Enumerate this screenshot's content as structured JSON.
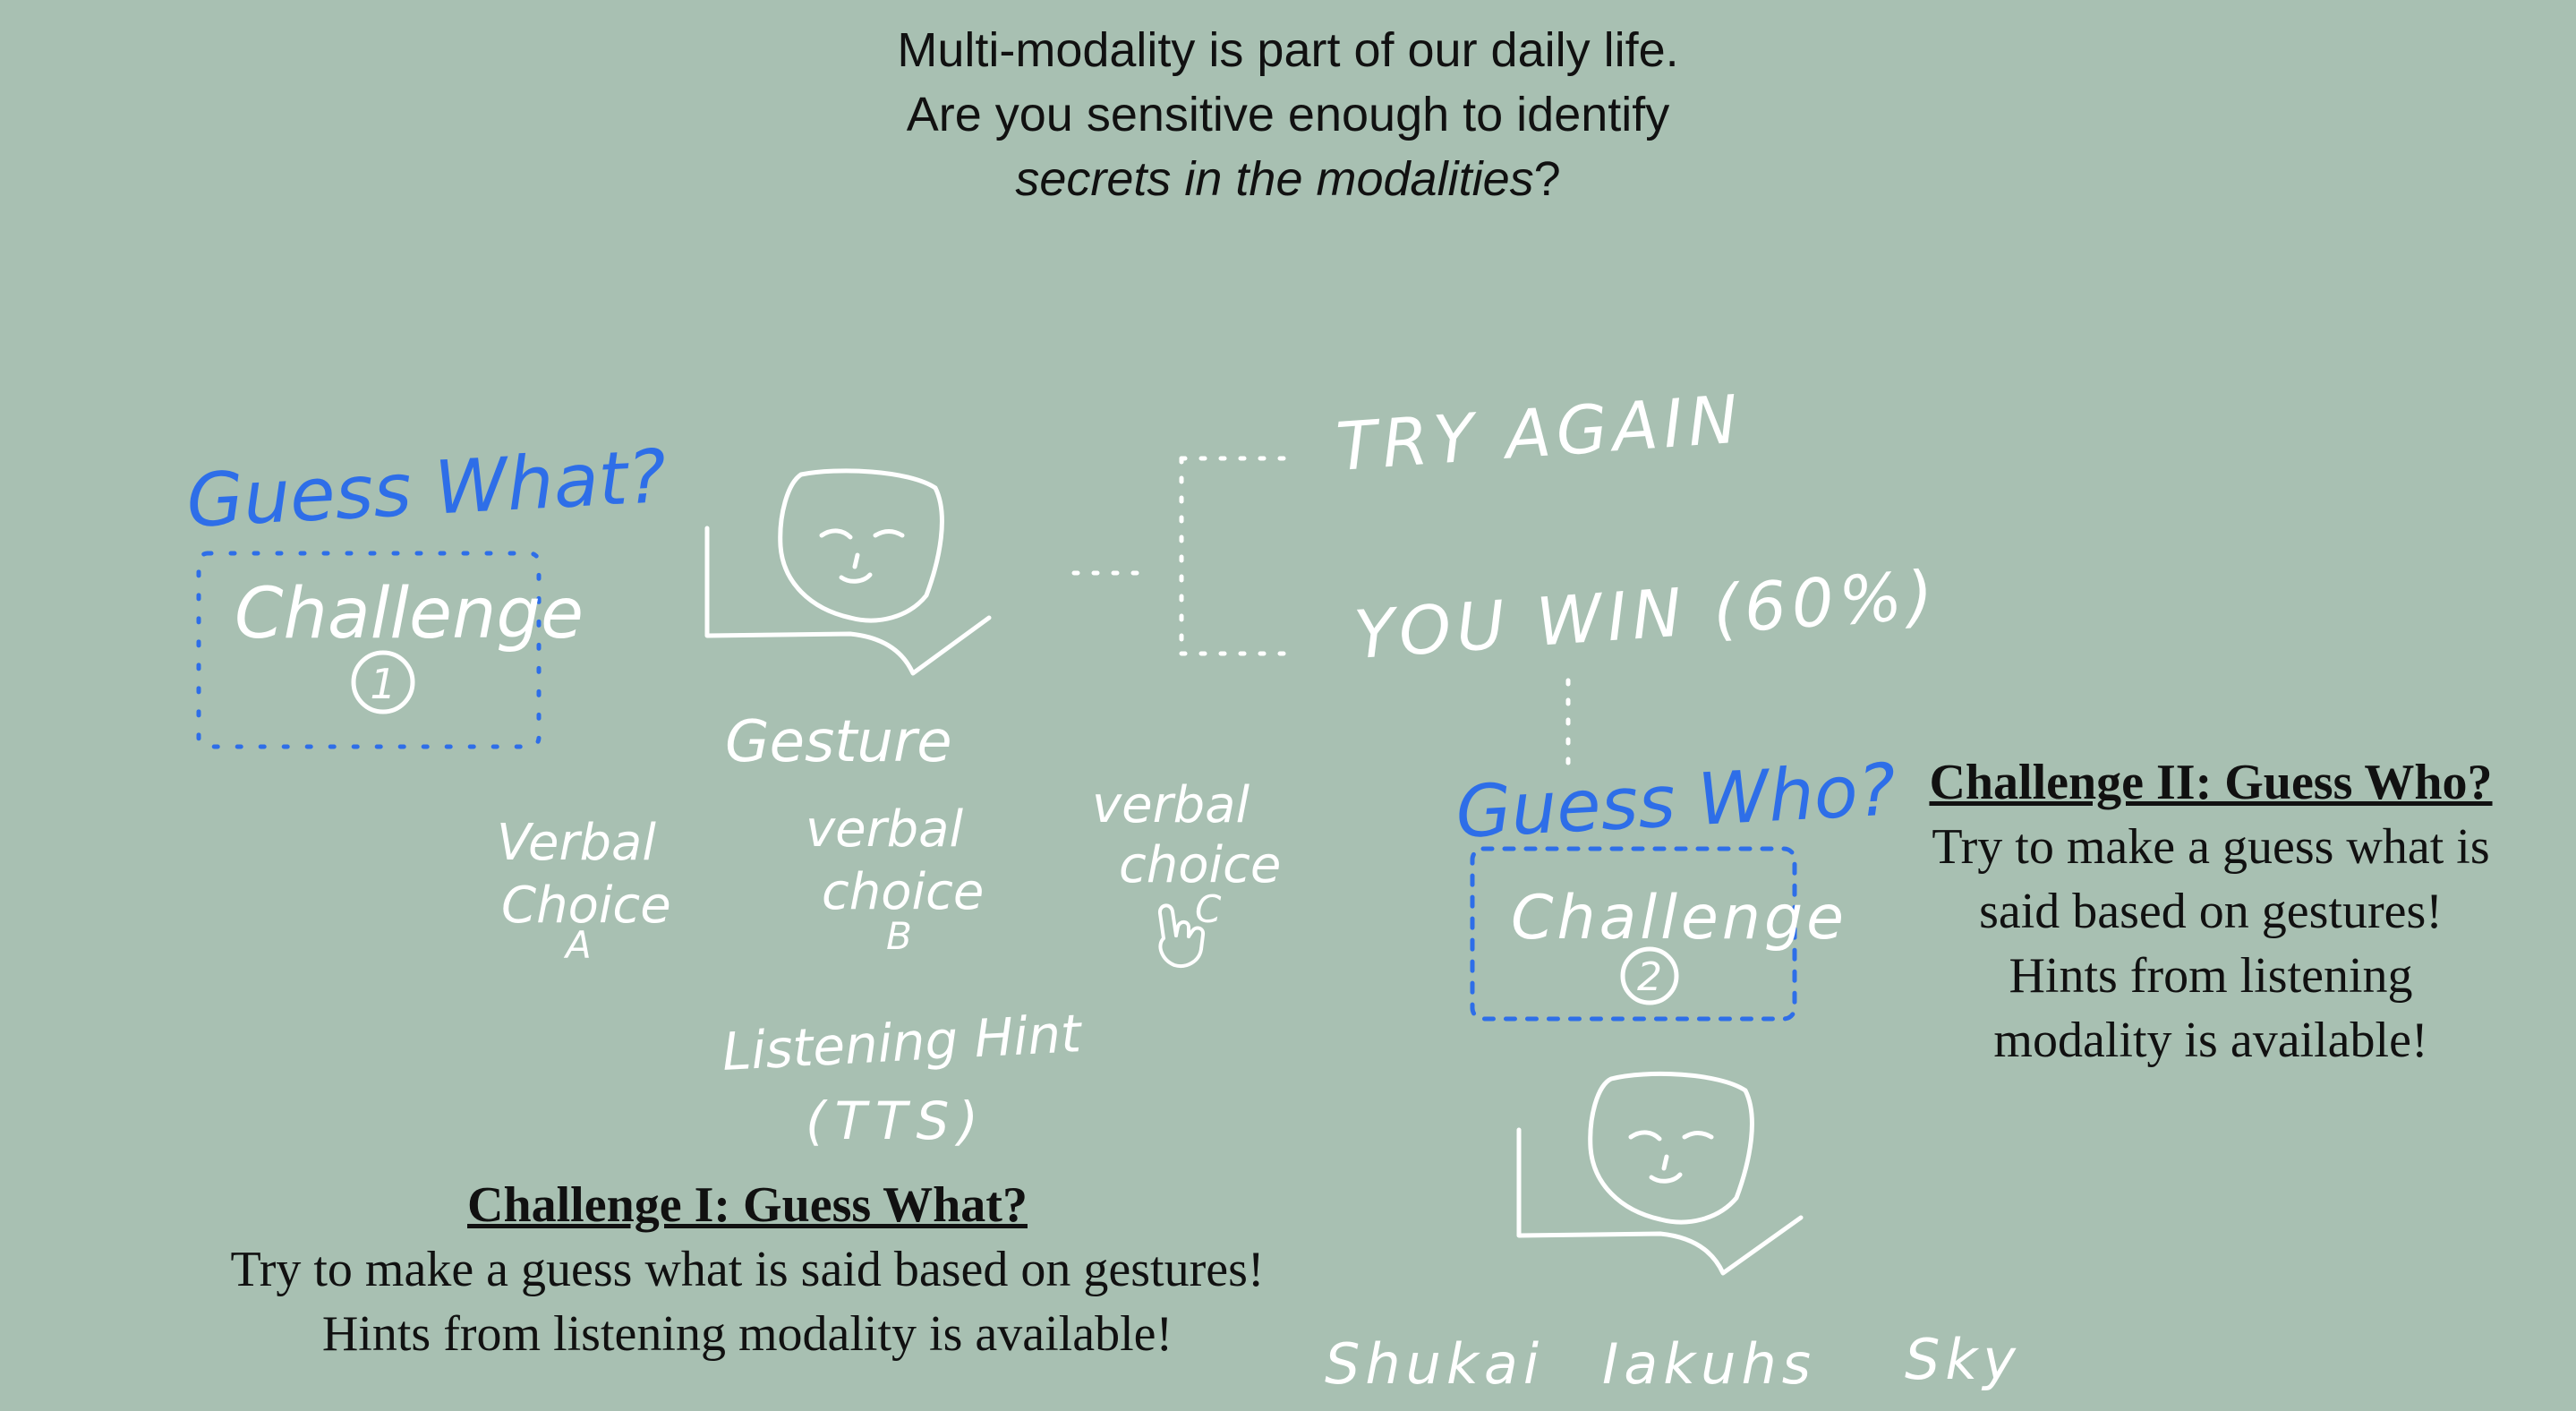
{
  "intro": {
    "line1": "Multi-modality is part of our daily life.",
    "line2": "Are you sensitive enough to identify",
    "line3_italic": "secrets in the modalities",
    "line3_tail": "?"
  },
  "sketch": {
    "guess_what": "Guess What?",
    "challenge_1": "Challenge",
    "challenge_1_num": "1",
    "gesture": "Gesture",
    "try_again": "TRY AGAIN",
    "you_win": "YOU WIN (60%)",
    "verbal_choice_a": [
      "Verbal",
      "Choice",
      "A"
    ],
    "verbal_choice_b": [
      "verbal",
      "choice",
      "B"
    ],
    "verbal_choice_c": [
      "verbal",
      "choice",
      "C"
    ],
    "listening_hint": [
      "Listening Hint",
      "(TTS)"
    ],
    "guess_who": "Guess Who?",
    "challenge_2": "Challenge",
    "challenge_2_num": "2",
    "names": [
      "Shukai",
      "Iakuhs",
      "Sky"
    ]
  },
  "challenge_one": {
    "title": "Challenge I: Guess What?",
    "line1": "Try to make a guess what is said based on gestures!",
    "line2": "Hints from listening modality is available!"
  },
  "challenge_two": {
    "title": "Challenge II: Guess Who?",
    "lines": [
      "Try to make a guess what is",
      "said based on gestures!",
      "Hints from listening",
      "modality is available!"
    ]
  },
  "colors": {
    "background": "#a8c0b2",
    "sketch": "#ffffff",
    "accent": "#2e6ee8",
    "text": "#111111"
  }
}
